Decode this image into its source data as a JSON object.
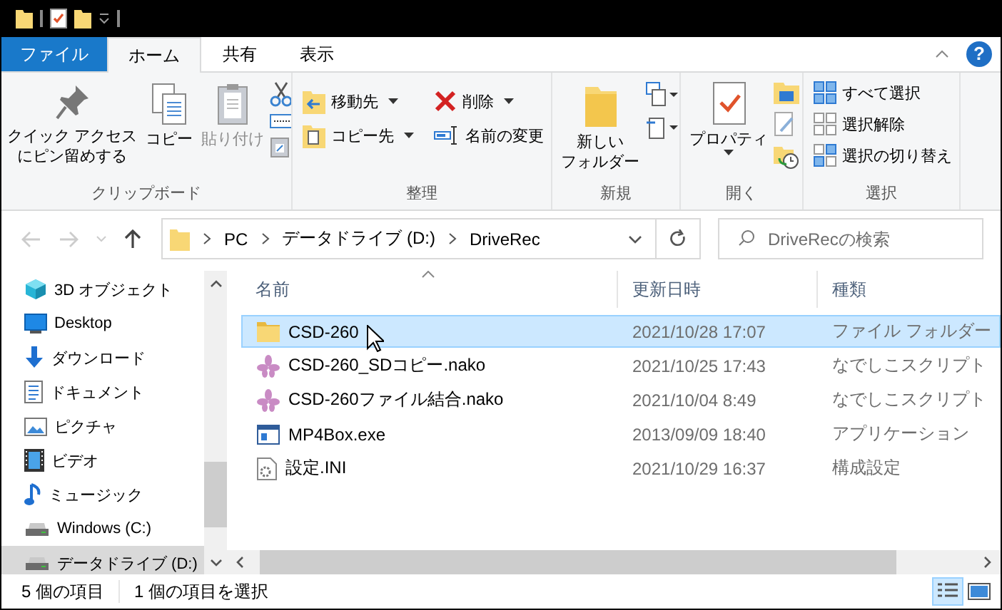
{
  "tabs": [
    {
      "label": "ファイル",
      "kind": "file",
      "selected": false
    },
    {
      "label": "ホーム",
      "kind": "tab",
      "selected": true
    },
    {
      "label": "共有",
      "kind": "tab",
      "selected": false
    },
    {
      "label": "表示",
      "kind": "tab",
      "selected": false
    }
  ],
  "help_button": "?",
  "ribbon": {
    "clipboard": {
      "label": "クリップボード",
      "pin": [
        "クイック アクセス",
        "にピン留めする"
      ],
      "copy": "コピー",
      "paste": {
        "label": "貼り付け",
        "disabled": true
      }
    },
    "organize": {
      "label": "整理",
      "move_to": "移動先",
      "copy_to": "コピー先",
      "delete": "削除",
      "rename": "名前の変更"
    },
    "new": {
      "label": "新規",
      "new_folder": [
        "新しい",
        "フォルダー"
      ]
    },
    "open": {
      "label": "開く",
      "properties": "プロパティ"
    },
    "select": {
      "label": "選択",
      "items": [
        "すべて選択",
        "選択解除",
        "選択の切り替え"
      ]
    }
  },
  "address": {
    "path": [
      "PC",
      "データドライブ (D:)",
      "DriveRec"
    ],
    "search_placeholder": "DriveRecの検索"
  },
  "nav": [
    {
      "label": "3D オブジェクト",
      "kind": "cube",
      "selected": false
    },
    {
      "label": "Desktop",
      "kind": "desktop",
      "selected": false
    },
    {
      "label": "ダウンロード",
      "kind": "download",
      "selected": false
    },
    {
      "label": "ドキュメント",
      "kind": "documents",
      "selected": false
    },
    {
      "label": "ピクチャ",
      "kind": "pictures",
      "selected": false
    },
    {
      "label": "ビデオ",
      "kind": "videos",
      "selected": false
    },
    {
      "label": "ミュージック",
      "kind": "music",
      "selected": false
    },
    {
      "label": "Windows (C:)",
      "kind": "drive",
      "selected": false
    },
    {
      "label": "データドライブ (D:)",
      "kind": "drive",
      "selected": true
    }
  ],
  "columns": [
    "名前",
    "更新日時",
    "種類"
  ],
  "files": [
    {
      "name": "CSD-260",
      "modified": "2021/10/28 17:07",
      "type": "ファイル フォルダー",
      "kind": "folder",
      "selected": true
    },
    {
      "name": "CSD-260_SDコピー.nako",
      "modified": "2021/10/25 17:43",
      "type": "なでしこスクリプト",
      "kind": "script",
      "selected": false
    },
    {
      "name": "CSD-260ファイル結合.nako",
      "modified": "2021/10/04 8:49",
      "type": "なでしこスクリプト",
      "kind": "script",
      "selected": false
    },
    {
      "name": "MP4Box.exe",
      "modified": "2013/09/09 18:40",
      "type": "アプリケーション",
      "kind": "app",
      "selected": false
    },
    {
      "name": "設定.INI",
      "modified": "2021/10/29 16:37",
      "type": "構成設定",
      "kind": "config",
      "selected": false
    }
  ],
  "status": {
    "count": "5 個の項目",
    "selection": "1 個の項目を選択"
  },
  "views": [
    {
      "kind": "details",
      "selected": true
    },
    {
      "kind": "tiles",
      "selected": false
    }
  ]
}
